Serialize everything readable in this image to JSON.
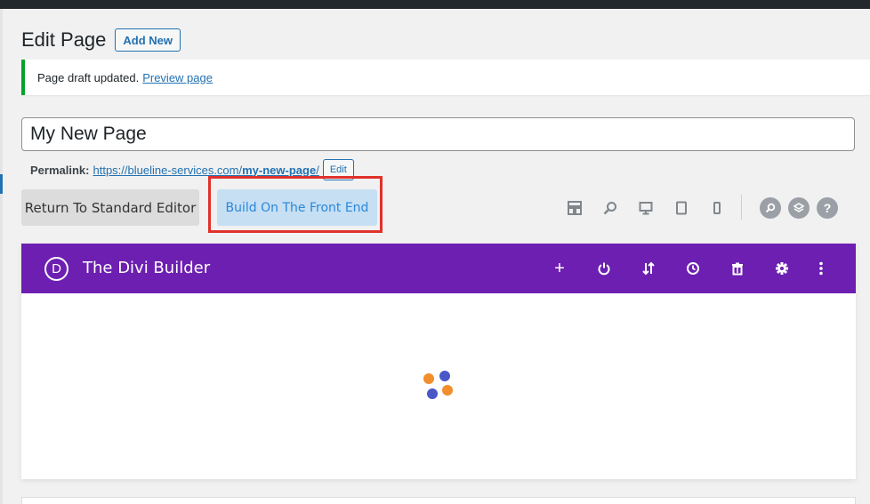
{
  "page": {
    "title": "Edit Page",
    "add_new_label": "Add New"
  },
  "notice": {
    "text": "Page draft updated.",
    "link": "Preview page",
    "color": "#00a32a"
  },
  "post_title": {
    "value": "My New Page"
  },
  "permalink": {
    "label": "Permalink:",
    "base": "https://blueline-services.com/",
    "slug": "my-new-page",
    "trail": "/",
    "edit_label": "Edit"
  },
  "builder_buttons": {
    "standard": "Return To Standard Editor",
    "frontend": "Build On The Front End"
  },
  "view_toolbar": {
    "icons": [
      "wireframe-icon",
      "zoom-icon",
      "desktop-icon",
      "tablet-icon",
      "phone-icon"
    ],
    "round_icons": [
      "search-icon",
      "layers-icon",
      "help-icon"
    ],
    "help_glyph": "?"
  },
  "divi": {
    "logo": "D",
    "title": "The Divi Builder",
    "header_color": "#6c1fb0",
    "header_icons": [
      "add-icon",
      "power-icon",
      "sort-icon",
      "history-icon",
      "trash-icon",
      "gear-icon",
      "more-icon"
    ],
    "add_glyph": "+"
  },
  "loader": {
    "colors": [
      "#f28e2b",
      "#4b57c7"
    ]
  }
}
